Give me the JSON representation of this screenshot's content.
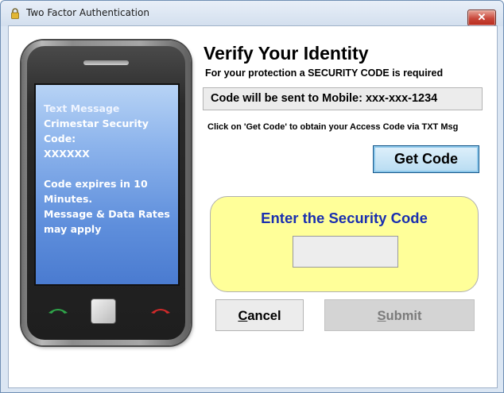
{
  "window": {
    "title": "Two Factor Authentication",
    "close_label": "✕",
    "icon": "padlock-icon"
  },
  "phone": {
    "sms_header": "Text Message",
    "sms_line1": "Crimestar Security Code:",
    "sms_line2": "XXXXXX",
    "sms_line3": "Code expires in 10",
    "sms_line4": "Minutes.",
    "sms_line5": "Message & Data Rates",
    "sms_line6": "may apply",
    "icons": [
      "earpiece-icon",
      "call-answer-icon",
      "home-button-icon",
      "call-end-icon"
    ]
  },
  "main": {
    "heading": "Verify Your Identity",
    "subheading": "For your protection a SECURITY CODE is required",
    "mobile_info": "Code will be sent to Mobile: xxx-xxx-1234",
    "instruction": "Click on 'Get Code' to obtain your Access Code via TXT Msg",
    "get_code_label": "Get Code"
  },
  "code_entry": {
    "label": "Enter the Security Code",
    "value": ""
  },
  "actions": {
    "cancel_first": "C",
    "cancel_rest": "ancel",
    "submit_first": "S",
    "submit_rest": "ubmit"
  },
  "colors": {
    "code_panel_bg": "#ffff99",
    "code_label": "#1a2fb0",
    "screen_blue": "#5f8fdc",
    "get_code_border": "#16578a",
    "submit_disabled_text": "#7b7b7b"
  }
}
